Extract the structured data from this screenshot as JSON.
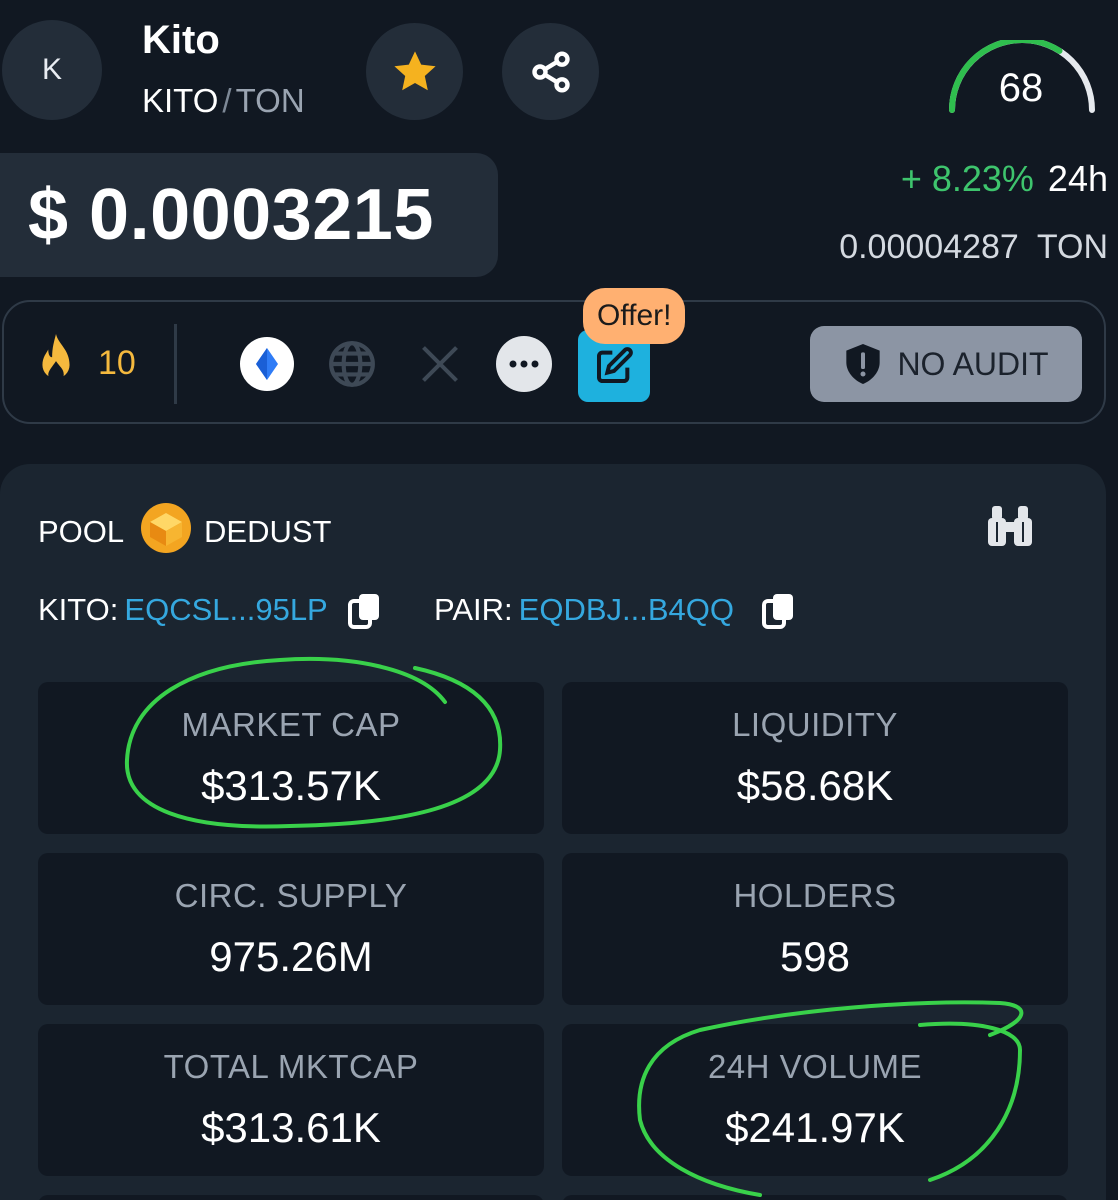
{
  "token": {
    "avatar_letter": "K",
    "name": "Kito",
    "symbol": "KITO",
    "pair_separator": "/",
    "quote": "TON"
  },
  "score": {
    "value": "68",
    "level": 0.68
  },
  "price": {
    "usd": "$ 0.0003215",
    "change_pct": "+ 8.23%",
    "change_period": "24h",
    "ton_value": "0.00004287",
    "ton_unit": "TON"
  },
  "action_bar": {
    "fire_count": "10",
    "offer_badge": "Offer!",
    "audit_label": "NO AUDIT",
    "icons": [
      "fire-icon",
      "ton-icon",
      "globe-icon",
      "x-icon",
      "more-icon",
      "edit-icon",
      "shield-alert-icon"
    ]
  },
  "pool": {
    "label": "POOL",
    "dex": "DEDUST",
    "kito_key": "KITO:",
    "kito_addr": "EQCSL...95LP",
    "pair_key": "PAIR:",
    "pair_addr": "EQDBJ...B4QQ"
  },
  "stats": [
    {
      "label": "MARKET CAP",
      "value": "$313.57K"
    },
    {
      "label": "LIQUIDITY",
      "value": "$58.68K"
    },
    {
      "label": "CIRC. SUPPLY",
      "value": "975.26M"
    },
    {
      "label": "HOLDERS",
      "value": "598"
    },
    {
      "label": "TOTAL MKTCAP",
      "value": "$313.61K"
    },
    {
      "label": "24H VOLUME",
      "value": "$241.97K"
    }
  ],
  "colors": {
    "background": "#111822",
    "panel": "#1b2530",
    "positive": "#3ec46d",
    "link": "#35a8df",
    "fire": "#f5b93e",
    "offer": "#ffb071",
    "annotation": "#39d14a"
  }
}
